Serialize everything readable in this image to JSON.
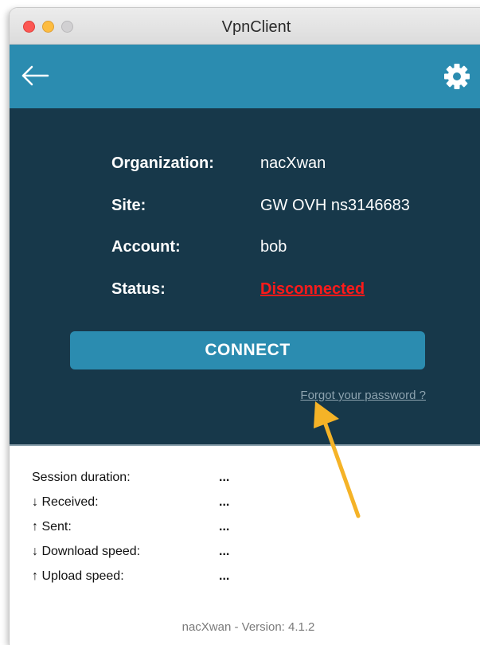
{
  "window": {
    "title": "VpnClient"
  },
  "toolbar": {
    "back_icon": "left-arrow-icon",
    "settings_icon": "gear-icon"
  },
  "account_info": {
    "organization": {
      "label": "Organization:",
      "value": "nacXwan"
    },
    "site": {
      "label": "Site:",
      "value": "GW OVH ns3146683"
    },
    "account": {
      "label": "Account:",
      "value": "bob"
    },
    "status": {
      "label": "Status:",
      "value": "Disconnected"
    }
  },
  "actions": {
    "connect_label": "CONNECT",
    "forgot_password_label": "Forgot your password ?"
  },
  "stats": [
    {
      "label": "Session duration:",
      "value": "..."
    },
    {
      "label": "↓ Received:",
      "value": "..."
    },
    {
      "label": "↑ Sent:",
      "value": "..."
    },
    {
      "label": "↓ Download speed:",
      "value": "..."
    },
    {
      "label": "↑ Upload speed:",
      "value": "..."
    }
  ],
  "footer": {
    "version_text": "nacXwan - Version: 4.1.2"
  },
  "colors": {
    "toolbar": "#2b8cb0",
    "panel": "#17384a",
    "button": "#2b8cb0",
    "status_disconnected": "#ff1a1a",
    "annotation_arrow": "#f5b327"
  }
}
